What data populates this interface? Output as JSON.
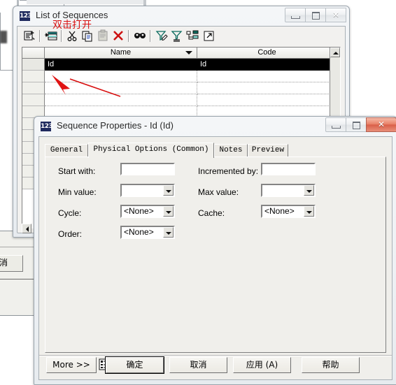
{
  "windows": {
    "list_of_sequences": {
      "title": "List of Sequences",
      "icon_label": "123",
      "icon_name": "app-123-icon",
      "controls": {
        "minimize": "minimize-icon",
        "restore": "restore-icon",
        "close": "close-icon"
      },
      "toolbar": [
        {
          "name": "properties-icon",
          "tip": "Properties"
        },
        {
          "name": "insert-row-icon",
          "tip": "Insert a Row"
        },
        {
          "name": "cut-icon",
          "tip": "Cut"
        },
        {
          "name": "copy-icon",
          "tip": "Copy"
        },
        {
          "name": "paste-icon",
          "tip": "Paste"
        },
        {
          "name": "delete-icon",
          "tip": "Delete"
        },
        {
          "name": "find-icon",
          "tip": "Find"
        },
        {
          "name": "include-filter-icon",
          "tip": "Customize Columns and Filter"
        },
        {
          "name": "filter-icon",
          "tip": "Apply Filter"
        },
        {
          "name": "tree-icon",
          "tip": "Display Children"
        },
        {
          "name": "open-icon",
          "tip": "Open"
        }
      ],
      "grid": {
        "columns": [
          "Name",
          "Code"
        ],
        "rows": [
          {
            "name": "Id",
            "code": "Id",
            "selected": true
          },
          {
            "name": "",
            "code": "",
            "selected": false
          },
          {
            "name": "",
            "code": "",
            "selected": false
          },
          {
            "name": "",
            "code": "",
            "selected": false
          },
          {
            "name": "",
            "code": "",
            "selected": false
          },
          {
            "name": "",
            "code": "",
            "selected": false
          },
          {
            "name": "",
            "code": "",
            "selected": false
          },
          {
            "name": "",
            "code": "",
            "selected": false
          },
          {
            "name": "",
            "code": "",
            "selected": false
          },
          {
            "name": "",
            "code": "",
            "selected": false
          },
          {
            "name": "",
            "code": "",
            "selected": false
          }
        ]
      }
    },
    "sequence_properties": {
      "title": "Sequence Properties - Id (Id)",
      "icon_label": "123",
      "tabs": [
        {
          "label": "General",
          "active": false
        },
        {
          "label": "Physical Options (Common)",
          "active": true
        },
        {
          "label": "Notes",
          "active": false
        },
        {
          "label": "Preview",
          "active": false
        }
      ],
      "fields": {
        "start_with": {
          "label": "Start with:",
          "value": ""
        },
        "incremented_by": {
          "label": "Incremented by:",
          "value": ""
        },
        "min_value": {
          "label": "Min value:",
          "value": ""
        },
        "max_value": {
          "label": "Max value:",
          "value": ""
        },
        "cycle": {
          "label": "Cycle:",
          "value": "<None>"
        },
        "cache": {
          "label": "Cache:",
          "value": "<None>"
        },
        "order": {
          "label": "Order:",
          "value": "<None>"
        }
      },
      "buttons": {
        "more": "More >>",
        "ok": "确定",
        "cancel": "取消",
        "apply": "应用 (A)",
        "help": "帮助"
      },
      "menu_icon_name": "report-list-icon"
    },
    "background_dialog": {
      "cancel_label": "取消"
    }
  },
  "annotation": {
    "text": "双击打开",
    "color": "#d81010",
    "arrow_name": "red-arrow-annotation"
  }
}
